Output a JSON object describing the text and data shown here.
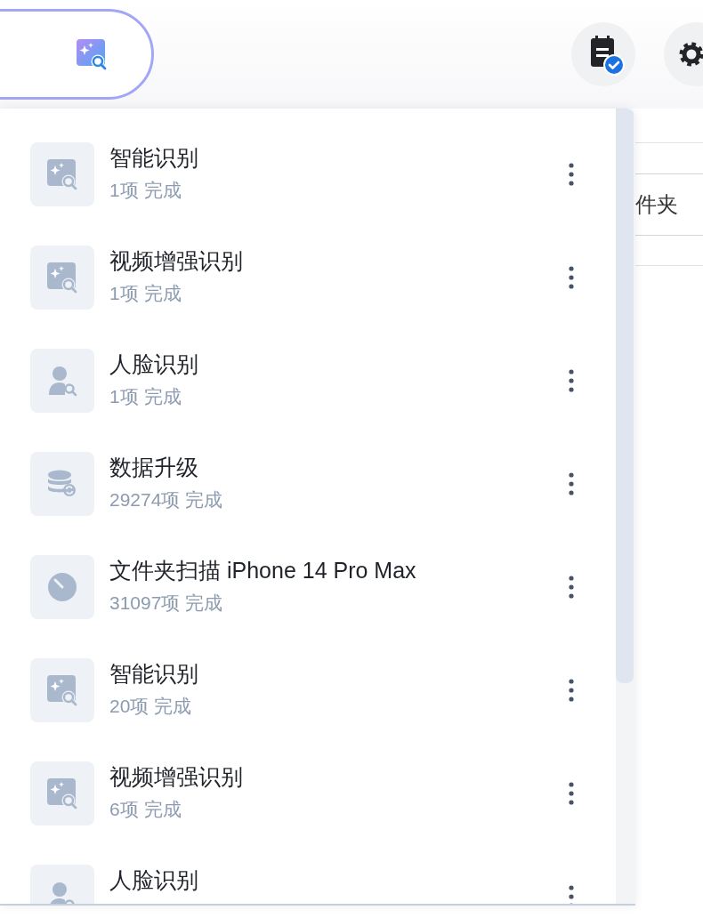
{
  "background": {
    "folder_tab": "件夹"
  },
  "task_menu": {
    "items": [
      {
        "kind": "smart",
        "title": "智能识别",
        "status": "1项 完成"
      },
      {
        "kind": "smart",
        "title": "视频增强识别",
        "status": "1项 完成"
      },
      {
        "kind": "face",
        "title": "人脸识别",
        "status": "1项 完成"
      },
      {
        "kind": "database",
        "title": "数据升级",
        "status": "29274项 完成"
      },
      {
        "kind": "scan",
        "title": "文件夹扫描 iPhone 14 Pro Max",
        "status": "31097项 完成"
      },
      {
        "kind": "smart",
        "title": "智能识别",
        "status": "20项 完成"
      },
      {
        "kind": "smart",
        "title": "视频增强识别",
        "status": "6项 完成"
      },
      {
        "kind": "face",
        "title": "人脸识别"
      }
    ]
  }
}
